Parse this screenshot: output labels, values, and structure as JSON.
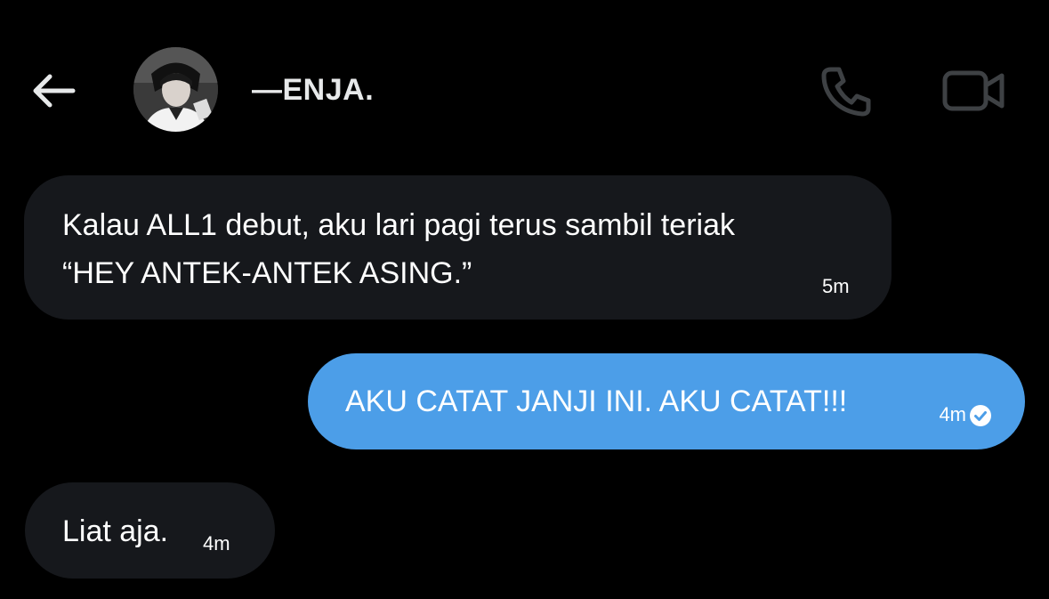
{
  "header": {
    "contact_name": "—ENJA.",
    "back_icon": "arrow-left-icon",
    "call_icon": "phone-icon",
    "video_icon": "video-camera-icon"
  },
  "messages": [
    {
      "direction": "incoming",
      "lines": [
        "Kalau ALL1 debut, aku lari pagi terus sambil teriak",
        "“HEY ANTEK-ANTEK ASING.”"
      ],
      "time": "5m"
    },
    {
      "direction": "outgoing",
      "lines": [
        "AKU CATAT JANJI INI. AKU CATAT!!!"
      ],
      "time": "4m",
      "status_icon": "read-check-icon"
    },
    {
      "direction": "incoming",
      "lines": [
        "Liat aja."
      ],
      "time": "4m"
    }
  ],
  "colors": {
    "background": "#000000",
    "incoming_bubble": "#16181c",
    "outgoing_bubble": "#4c9ee8",
    "header_icons": "#3e4144",
    "back_icon": "#e7e9ea"
  }
}
